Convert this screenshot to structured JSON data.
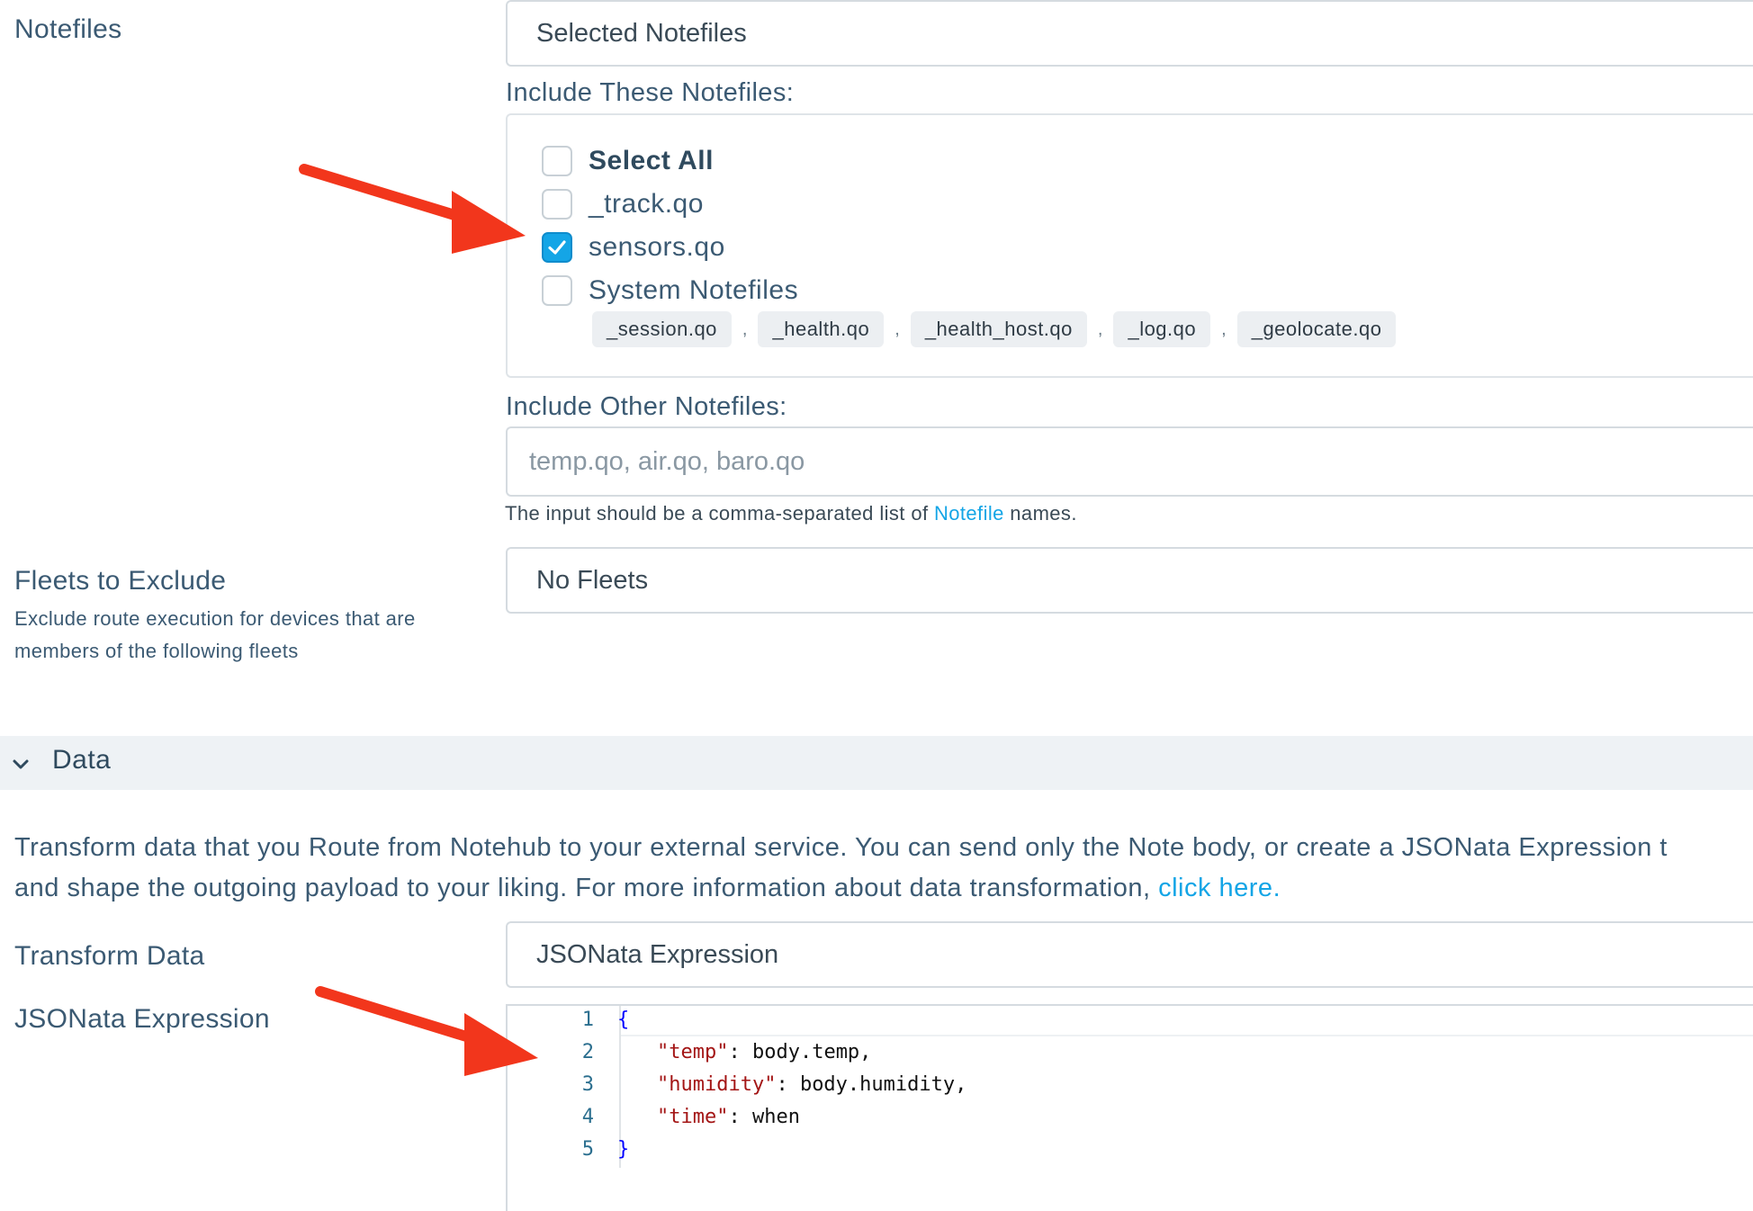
{
  "notefiles": {
    "label": "Notefiles",
    "select_value": "Selected Notefiles",
    "include_label": "Include These Notefiles:",
    "checkboxes": [
      {
        "label": "Select All",
        "checked": false
      },
      {
        "label": "_track.qo",
        "checked": false
      },
      {
        "label": "sensors.qo",
        "checked": true
      },
      {
        "label": "System Notefiles",
        "checked": false
      }
    ],
    "system_chips": [
      "_session.qo",
      "_health.qo",
      "_health_host.qo",
      "_log.qo",
      "_geolocate.qo"
    ],
    "chip_separator": ",",
    "other_label": "Include Other Notefiles:",
    "other_placeholder": "temp.qo, air.qo, baro.qo",
    "help_prefix": "The input should be a comma-separated list of ",
    "help_link": "Notefile",
    "help_suffix": " names."
  },
  "fleets": {
    "label": "Fleets to Exclude",
    "description": "Exclude route execution for devices that are members of the following fleets",
    "select_value": "No Fleets"
  },
  "data_section": {
    "title": "Data",
    "paragraph_line1": "Transform data that you Route from Notehub to your external service. You can send only the Note body, or create a JSONata Expression t",
    "paragraph_line2": "and shape the outgoing payload to your liking. For more information about data transformation, ",
    "paragraph_link": "click here.",
    "transform_label": "Transform Data",
    "transform_value": "JSONata Expression",
    "expression_label": "JSONata Expression",
    "code_lines": [
      {
        "n": "1",
        "open": "{"
      },
      {
        "n": "2",
        "key": "\"temp\"",
        "rest": ": body.temp,"
      },
      {
        "n": "3",
        "key": "\"humidity\"",
        "rest": ": body.humidity,"
      },
      {
        "n": "4",
        "key": "\"time\"",
        "rest": ": when"
      },
      {
        "n": "5",
        "close": "}"
      }
    ]
  },
  "colors": {
    "accent": "#14a5e6",
    "annotation_arrow": "#f2361c",
    "label_text": "#3b5a73",
    "section_bar": "#eef2f5"
  },
  "icons": {
    "checkmark": "check-icon",
    "collapse": "chevron-down-icon",
    "annotation": "arrow-annotation"
  }
}
